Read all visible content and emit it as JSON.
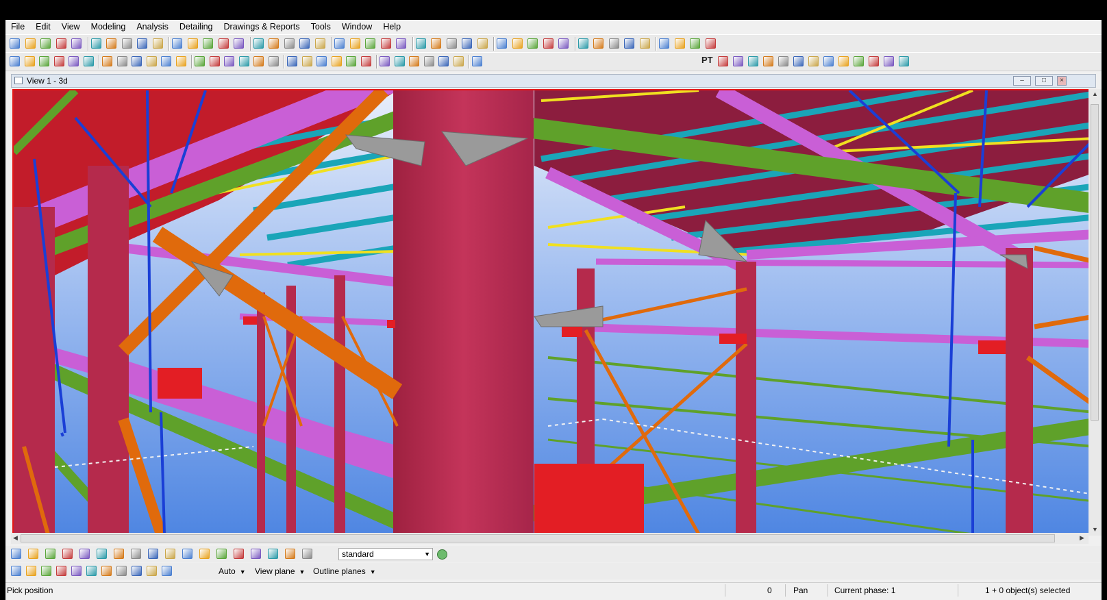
{
  "menubar": {
    "items": [
      "File",
      "Edit",
      "View",
      "Modeling",
      "Analysis",
      "Detailing",
      "Drawings & Reports",
      "Tools",
      "Window",
      "Help"
    ]
  },
  "view_window": {
    "title": "View 1 - 3d",
    "minimize_label": "–",
    "restore_label": "□",
    "close_label": "×"
  },
  "toolbar2": {
    "text_button": "PT"
  },
  "selection_bar": {
    "filter_value": "standard",
    "snap_mode": "Auto",
    "plane_mode": "View plane",
    "outline_mode": "Outline planes"
  },
  "statusbar": {
    "prompt": "Pick position",
    "value": "0",
    "mode": "Pan",
    "phase": "Current phase: 1",
    "selection": "1 + 0 object(s) selected"
  },
  "colors": {
    "frame_column": "#b52a4c",
    "green_beam": "#5fa12a",
    "magenta_beam": "#c95fd6",
    "orange_brace": "#e06a0c",
    "cyan_purlin": "#1aa5b8",
    "yellow_line": "#f0e020",
    "blue_rod": "#1a3fd6",
    "sky_top": "#d9e6f8",
    "sky_bottom": "#4f8ae3",
    "active_border": "#e31818"
  },
  "icons": {
    "toolbar1": [
      "new-model-icon",
      "open-model-icon",
      "save-icon",
      "undo-icon",
      "redo-icon",
      "copy-icon",
      "move-icon",
      "print-icon",
      "properties-icon",
      "create-view-icon",
      "view-list-icon",
      "open-views-icon",
      "cut-icon",
      "select-all-icon",
      "clash-icon",
      "drawing-icon",
      "report-icon",
      "numbering-icon",
      "interrupt-icon",
      "help-icon",
      "grid-icon",
      "point-icon",
      "line-icon",
      "arc-icon",
      "cut-line-icon",
      "model-organizer-icon",
      "component-icon",
      "catalog-icon",
      "reports-icon",
      "drawing-list-icon",
      "phase-icon",
      "save-as-icon",
      "measure-icon",
      "distance-icon",
      "angle-icon",
      "snap-point-icon",
      "snap-end-icon",
      "snap-center-icon",
      "query-icon",
      "inquire-icon",
      "sequence-icon",
      "log-icon",
      "layout-icon",
      "convert-icon"
    ],
    "toolbar2": [
      "lock-icon",
      "unlock-icon",
      "column-icon",
      "beam-icon",
      "polybeam-icon",
      "curved-beam-icon",
      "panel-icon",
      "bolt-icon",
      "weld-icon",
      "reinforcement-icon",
      "rebar-icon",
      "slab-icon",
      "strip-footing-icon",
      "pad-footing-icon",
      "connection-icon",
      "macro-icon",
      "binoculars-icon",
      "hierarchy-icon",
      "assembly-icon",
      "box-icon",
      "cut-part-icon",
      "fit-icon",
      "split-icon",
      "combine-icon",
      "align-icon",
      "axis-icon",
      "arrow-left-icon",
      "arrow-right-icon",
      "number-icon",
      "end-plate-icon",
      "stiffener-icon",
      "haunch-icon",
      "base-plate-icon",
      "splice-icon",
      "cleat-icon",
      "shear-plate-icon",
      "stair-icon",
      "purlin-icon",
      "bracing-icon",
      "truss-icon",
      "frame-icon",
      "ladder-icon",
      "handrail-icon",
      "table-icon"
    ],
    "selection_filter": [
      "select-all-icon",
      "select-part-icon",
      "select-surface-icon",
      "select-point-icon",
      "select-grid-icon",
      "select-weld-icon",
      "select-cut-icon",
      "select-view-icon",
      "select-bolt-icon",
      "select-component-icon",
      "select-assembly-icon",
      "select-object-icon",
      "select-reference-icon",
      "select-control-icon",
      "select-group-icon",
      "select-layer-icon",
      "select-level-icon",
      "filter-edit-icon"
    ],
    "snap_switches": [
      "snap-reference-icon",
      "snap-geometry-icon",
      "snap-nearest-icon",
      "snap-midpoint-icon",
      "snap-intersection-icon",
      "snap-perpendicular-icon",
      "snap-extension-icon",
      "snap-any-icon",
      "snap-line-icon",
      "snap-override-icon",
      "snap-lock-icon"
    ]
  }
}
